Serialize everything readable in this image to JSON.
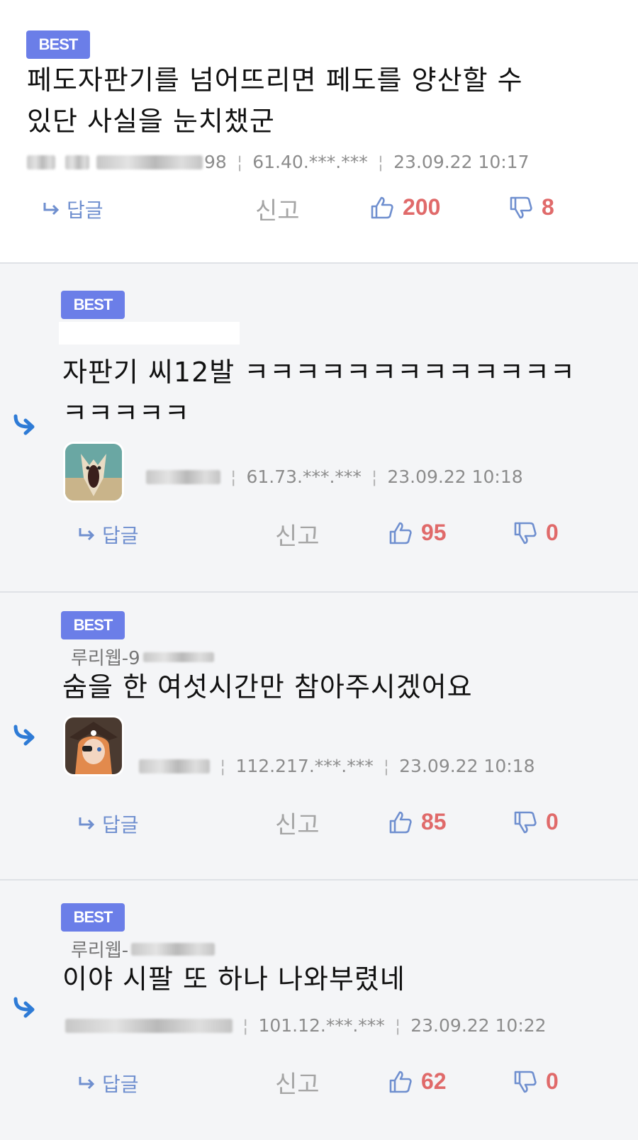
{
  "colors": {
    "badge": "#6b7ee8",
    "vote_count": "#e06a6a",
    "reply": "#6f8fcf",
    "reply_marker": "#2e7bd6",
    "meta_text": "#8c8c8c",
    "reply_bg": "#f4f5f7"
  },
  "icons": {
    "reply": "reply-arrow-icon",
    "upvote": "thumbs-up-icon",
    "downvote": "thumbs-down-icon",
    "reply_marker": "reply-indent-arrow-icon"
  },
  "comments": [
    {
      "badge": "BEST",
      "author_prefix": "",
      "body": [
        "페도자판기를 넘어뜨리면 페도를 양산할 수",
        "있단 사실을 눈치챘군"
      ],
      "author_tail": "98",
      "ip": "61.40.***.***",
      "datetime": "23.09.22 10:17",
      "reply_label": "답글",
      "report_label": "신고",
      "upvotes": "200",
      "downvotes": "8"
    },
    {
      "badge": "BEST",
      "author_prefix": "",
      "body": [
        "자판기 씨12발 ㅋㅋㅋㅋㅋㅋㅋㅋㅋㅋㅋㅋㅋ",
        "ㅋㅋㅋㅋㅋ"
      ],
      "author_tail": "",
      "ip": "61.73.***.***",
      "datetime": "23.09.22 10:18",
      "reply_label": "답글",
      "report_label": "신고",
      "upvotes": "95",
      "downvotes": "0"
    },
    {
      "badge": "BEST",
      "author_prefix": "루리웹-9",
      "body": [
        "숨을 한 여섯시간만 참아주시겠어요"
      ],
      "author_tail": "",
      "ip": "112.217.***.***",
      "datetime": "23.09.22 10:18",
      "reply_label": "답글",
      "report_label": "신고",
      "upvotes": "85",
      "downvotes": "0"
    },
    {
      "badge": "BEST",
      "author_prefix": "루리웹-",
      "body": [
        "이야 시팔 또 하나 나와부렸네"
      ],
      "author_tail": "",
      "ip": "101.12.***.***",
      "datetime": "23.09.22 10:22",
      "reply_label": "답글",
      "report_label": "신고",
      "upvotes": "62",
      "downvotes": "0"
    }
  ]
}
